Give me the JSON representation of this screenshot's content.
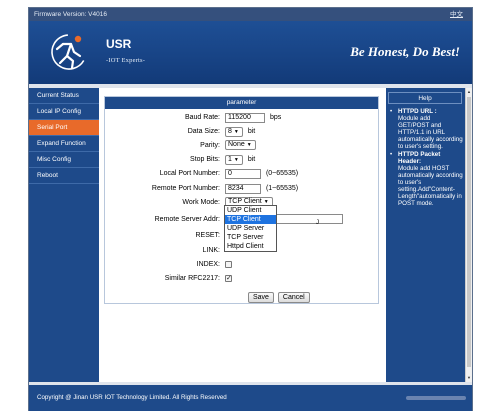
{
  "topbar": {
    "firmware": "Firmware Version: V4016",
    "lang": "中文"
  },
  "header": {
    "brand": "USR",
    "brand_sub": "-IOT Experts-",
    "slogan": "Be Honest, Do Best!"
  },
  "sidebar": {
    "items": [
      {
        "label": "Current Status"
      },
      {
        "label": "Local IP Config"
      },
      {
        "label": "Serial Port"
      },
      {
        "label": "Expand Function"
      },
      {
        "label": "Misc Config"
      },
      {
        "label": "Reboot"
      }
    ],
    "active_index": 2
  },
  "panel": {
    "title": "parameter"
  },
  "form": {
    "baud_rate": {
      "label": "Baud Rate:",
      "value": "115200",
      "unit": "bps"
    },
    "data_size": {
      "label": "Data Size:",
      "value": "8",
      "unit": "bit"
    },
    "parity": {
      "label": "Parity:",
      "value": "None"
    },
    "stop_bits": {
      "label": "Stop Bits:",
      "value": "1",
      "unit": "bit"
    },
    "local_port": {
      "label": "Local Port Number:",
      "value": "0",
      "range": "(0~65535)"
    },
    "remote_port": {
      "label": "Remote Port Number:",
      "value": "8234",
      "range": "(1~65535)"
    },
    "work_mode": {
      "label": "Work Mode:",
      "value": "TCP Client"
    },
    "remote_server": {
      "label": "Remote Server Addr:",
      "value": "",
      "suffix": "J"
    },
    "reset": {
      "label": "RESET:"
    },
    "link": {
      "label": "LINK:"
    },
    "index": {
      "label": "INDEX:",
      "checked": false
    },
    "rfc2217": {
      "label": "Similar RFC2217:",
      "checked": true
    }
  },
  "dropdown": {
    "options": [
      "UDP Client",
      "TCP Client",
      "UDP Server",
      "TCP Server",
      "Httpd Client"
    ],
    "highlighted_index": 1
  },
  "buttons": {
    "save": "Save",
    "cancel": "Cancel"
  },
  "help": {
    "title": "Help",
    "items": [
      {
        "title": "HTTPD URL :",
        "text": "Module add GET/POST and HTTP/1.1 in URL automatically according to user's setting."
      },
      {
        "title": "HTTPD Packet Header:",
        "text": "Module add HOST automatically according to user's setting.Add\"Content-Length\"automatically in POST mode."
      }
    ]
  },
  "footer": {
    "copyright": "Copyright @ Jinan USR IOT Technology Limited. All Rights Reserved"
  },
  "colors": {
    "navy": "#1e4a8a",
    "accent": "#e86a2a",
    "highlight": "#1e73e0"
  }
}
